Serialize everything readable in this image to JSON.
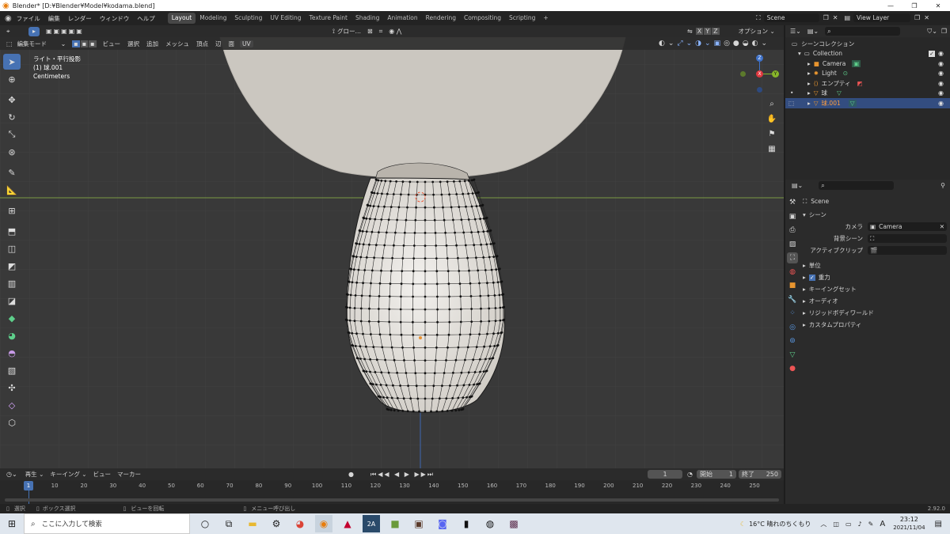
{
  "window": {
    "title": "Blender* [D:¥Blender¥Model¥kodama.blend]",
    "controls": [
      "—",
      "❐",
      "✕"
    ]
  },
  "menu": {
    "items": [
      "ファイル",
      "編集",
      "レンダー",
      "ウィンドウ",
      "ヘルプ"
    ]
  },
  "workspaces": [
    "Layout",
    "Modeling",
    "Sculpting",
    "UV Editing",
    "Texture Paint",
    "Shading",
    "Animation",
    "Rendering",
    "Compositing",
    "Scripting",
    "+"
  ],
  "scene": {
    "name": "Scene",
    "view_layer": "View Layer"
  },
  "toolheader": {
    "orientation": "グロー…",
    "options": "オプション ⌄",
    "axes": [
      "X",
      "Y",
      "Z"
    ]
  },
  "viewport_header": {
    "mode": "編集モード",
    "menus": [
      "ビュー",
      "選択",
      "追加",
      "メッシュ",
      "頂点",
      "辺",
      "面",
      "UV"
    ]
  },
  "viewport_info": {
    "line1": "ライト・平行投影",
    "line2": "(1) 球.001",
    "line3": "Centimeters"
  },
  "gizmo": {
    "z": "Z",
    "x": "X",
    "y": "Y"
  },
  "outliner": {
    "title": "シーンコレクション",
    "collection": "Collection",
    "items": [
      {
        "name": "Camera",
        "icon": "camera-icon"
      },
      {
        "name": "Light",
        "icon": "light-icon"
      },
      {
        "name": "エンプティ",
        "icon": "empty-icon"
      },
      {
        "name": "球",
        "icon": "mesh-icon"
      },
      {
        "name": "球.001",
        "icon": "mesh-icon"
      }
    ]
  },
  "properties": {
    "crumb": "Scene",
    "section": "シーン",
    "fields": [
      {
        "label": "カメラ",
        "value": "Camera"
      },
      {
        "label": "背景シーン",
        "value": ""
      },
      {
        "label": "アクティブクリップ",
        "value": ""
      }
    ],
    "panels": [
      "単位",
      "重力",
      "キーイングセット",
      "オーディオ",
      "リジッドボディワールド",
      "カスタムプロパティ"
    ]
  },
  "timeline": {
    "menus": [
      "再生 ⌄",
      "キーイング ⌄",
      "ビュー",
      "マーカー"
    ],
    "current": "1",
    "start_label": "開始",
    "start": "1",
    "end_label": "終了",
    "end": "250",
    "ticks": [
      "1",
      "10",
      "20",
      "30",
      "40",
      "50",
      "60",
      "70",
      "80",
      "90",
      "100",
      "110",
      "120",
      "130",
      "140",
      "150",
      "160",
      "170",
      "180",
      "190",
      "200",
      "210",
      "220",
      "230",
      "240",
      "250"
    ]
  },
  "status": {
    "select": "選択",
    "box": "ボックス選択",
    "rotate": "ビューを回転",
    "menu": "メニュー呼び出し",
    "version": "2.92.0"
  },
  "taskbar": {
    "search": "ここに入力して検索",
    "weather": "16°C  晴れのちくもり",
    "ime": "A",
    "time": "23:12",
    "date": "2021/11/04"
  },
  "colors": {
    "accent": "#4772b3",
    "header": "#2b2b2b",
    "viewport": "#393939",
    "mesh": "#cfcbc4"
  }
}
